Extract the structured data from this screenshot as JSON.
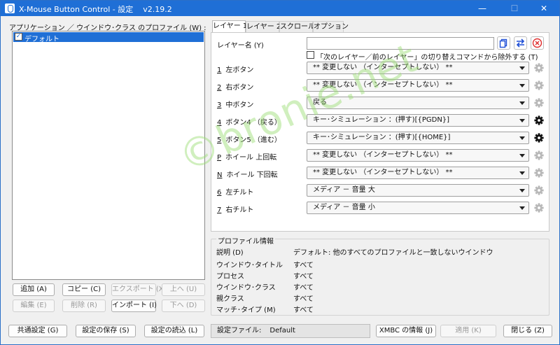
{
  "window": {
    "title": "X-Mouse Button Control - 設定",
    "version": "v2.19.2",
    "controls": {
      "minimize": "—",
      "maximize": "☐",
      "close": "✕"
    }
  },
  "left": {
    "group_label": "アプリケーション ／ ウインドウ･クラス のプロファイル (W) :",
    "profiles": [
      {
        "label": "デフォルト",
        "checked": true,
        "selected": true
      }
    ],
    "buttons": {
      "add": "追加 (A)",
      "copy": "コピー (C)",
      "export": "エクスポート (X)",
      "up": "上へ (U)",
      "edit": "編集 (E)",
      "delete": "削除 (R)",
      "import": "インポート (I)",
      "down": "下へ (D)"
    }
  },
  "tabs": [
    "レイヤー 1",
    "レイヤー 2",
    "スクロール",
    "オプション"
  ],
  "layer": {
    "name_label": "レイヤー名 (Y)",
    "name_value": "",
    "exclude_label": "「次のレイヤー／前のレイヤー」の切り替えコマンドから除外する (T)",
    "rows": [
      {
        "key": "1",
        "label": "左ボタン",
        "value": "** 変更しない （インターセプトしない） **",
        "gear_active": false
      },
      {
        "key": "2",
        "label": "右ボタン",
        "value": "** 変更しない （インターセプトしない） **",
        "gear_active": false
      },
      {
        "key": "3",
        "label": "中ボタン",
        "value": "戻る",
        "gear_active": false
      },
      {
        "key": "4",
        "label": "ボタン4 （戻る）",
        "value": "キー･シミュレーション ：(押す)[{PGDN}]",
        "gear_active": true
      },
      {
        "key": "5",
        "label": "ボタン5 （進む）",
        "value": "キー･シミュレーション ：(押す)[{HOME}]",
        "gear_active": true
      },
      {
        "key": "P",
        "label": "ホイール 上回転",
        "value": "** 変更しない （インターセプトしない） **",
        "gear_active": false
      },
      {
        "key": "N",
        "label": "ホイール 下回転",
        "value": "** 変更しない （インターセプトしない） **",
        "gear_active": false
      },
      {
        "key": "6",
        "label": "左チルト",
        "value": "メディア － 音量 大",
        "gear_active": false
      },
      {
        "key": "7",
        "label": "右チルト",
        "value": "メディア － 音量 小",
        "gear_active": false
      }
    ]
  },
  "profile_info": {
    "title": "プロファイル情報",
    "rows": [
      {
        "k": "説明 (D)",
        "v": "デフォルト: 他のすべてのプロファイルと一致しないウインドウ"
      },
      {
        "k": "ウインドウ･タイトル",
        "v": "すべて"
      },
      {
        "k": "プロセス",
        "v": "すべて"
      },
      {
        "k": "ウインドウ･クラス",
        "v": "すべて"
      },
      {
        "k": "親クラス",
        "v": "すべて"
      },
      {
        "k": "マッチ･タイプ (M)",
        "v": "すべて"
      }
    ]
  },
  "bottom": {
    "common_settings": "共通設定 (G)",
    "save_settings": "設定の保存 (S)",
    "load_settings": "設定の読込 (L)",
    "settings_file_label": "設定ファイル:",
    "settings_file_value": "Default",
    "about": "XMBC の情報 (J)",
    "apply": "適用 (K)",
    "close": "閉じる (Z)"
  },
  "watermark": "©bronie.net",
  "colors": {
    "accent": "#1f6fd6",
    "delete_red": "#e03030",
    "swap_blue": "#1f4fd6"
  },
  "icons": [
    "copy-layer-icon",
    "swap-layers-icon",
    "delete-layer-icon",
    "gear-icon"
  ]
}
